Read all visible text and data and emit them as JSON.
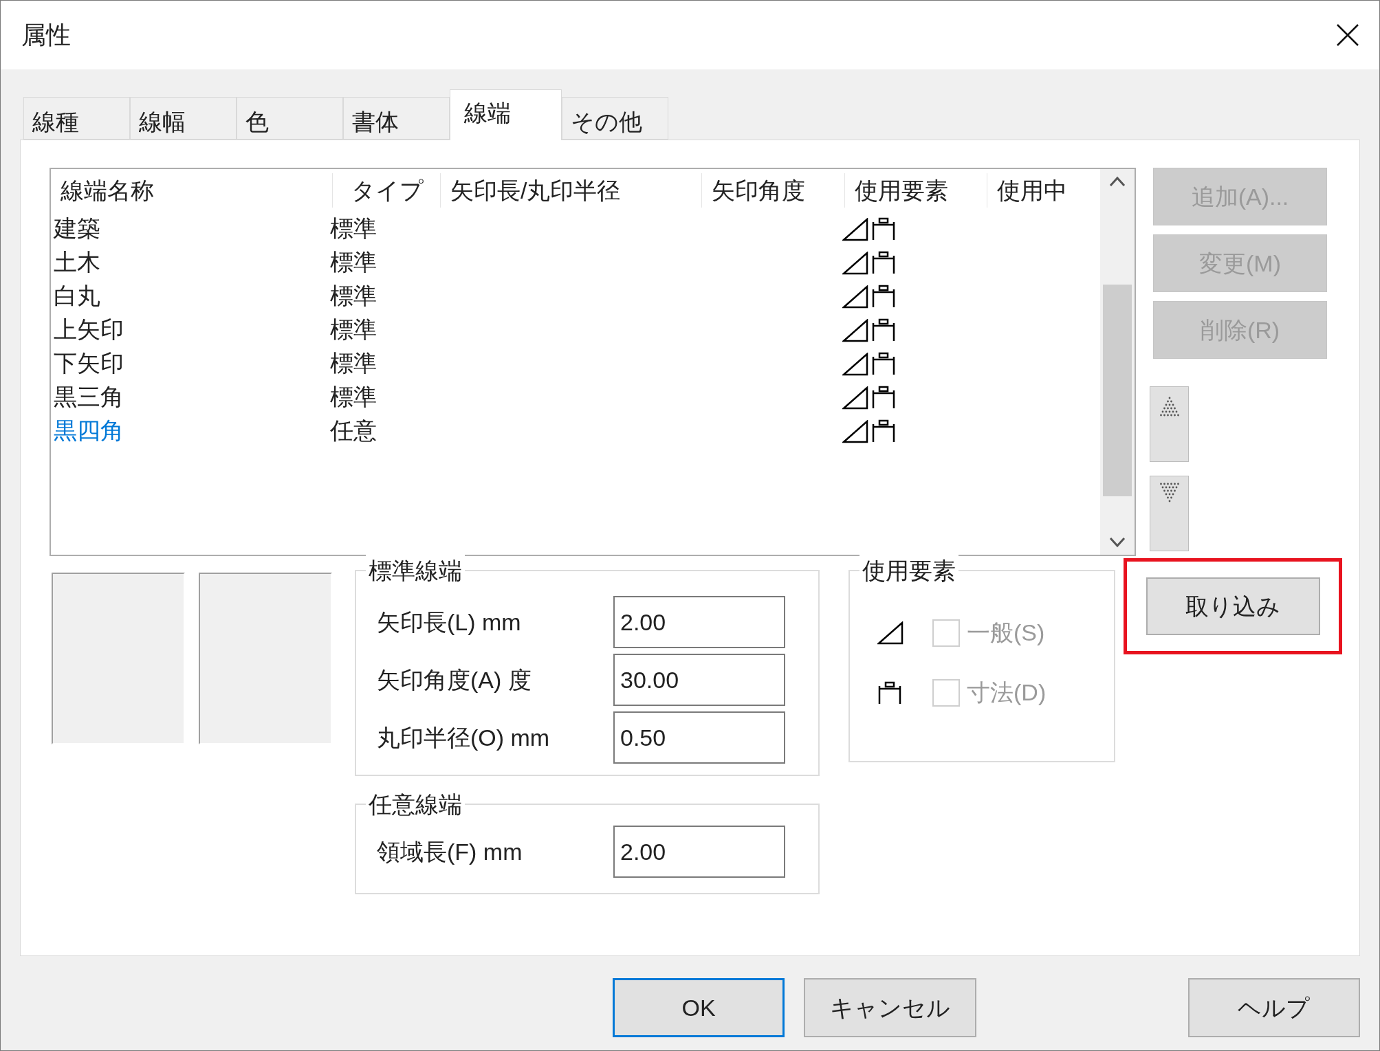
{
  "window": {
    "title": "属性"
  },
  "tabs": [
    {
      "label": "線種",
      "selected": false
    },
    {
      "label": "線幅",
      "selected": false
    },
    {
      "label": "色",
      "selected": false
    },
    {
      "label": "書体",
      "selected": false
    },
    {
      "label": "線端",
      "selected": true
    },
    {
      "label": "その他",
      "selected": false
    }
  ],
  "list": {
    "columns": [
      "線端名称",
      "タイプ",
      "矢印長/丸印半径",
      "矢印角度",
      "使用要素",
      "使用中"
    ],
    "rows": [
      {
        "name": "建築",
        "type": "標準",
        "selected": false
      },
      {
        "name": "土木",
        "type": "標準",
        "selected": false
      },
      {
        "name": "白丸",
        "type": "標準",
        "selected": false
      },
      {
        "name": "上矢印",
        "type": "標準",
        "selected": false
      },
      {
        "name": "下矢印",
        "type": "標準",
        "selected": false
      },
      {
        "name": "黒三角",
        "type": "標準",
        "selected": false
      },
      {
        "name": "黒四角",
        "type": "任意",
        "selected": true
      }
    ]
  },
  "side_buttons": [
    {
      "label": "追加(A)...",
      "disabled": true
    },
    {
      "label": "変更(M)",
      "disabled": true
    },
    {
      "label": "削除(R)",
      "disabled": true
    }
  ],
  "standard_end": {
    "title": "標準線端",
    "fields": [
      {
        "label": "矢印長(L) mm",
        "value": "2.00"
      },
      {
        "label": "矢印角度(A) 度",
        "value": "30.00"
      },
      {
        "label": "丸印半径(O) mm",
        "value": "0.50"
      }
    ]
  },
  "arbitrary_end": {
    "title": "任意線端",
    "fields": [
      {
        "label": "領域長(F) mm",
        "value": "2.00"
      }
    ]
  },
  "usage": {
    "title": "使用要素",
    "options": [
      {
        "kind": "general",
        "label": "一般(S)",
        "checked": false,
        "disabled": true
      },
      {
        "kind": "dimension",
        "label": "寸法(D)",
        "checked": false,
        "disabled": true
      }
    ]
  },
  "import_button": {
    "label": "取り込み",
    "highlighted": true
  },
  "footer_buttons": [
    {
      "label": "OK",
      "default": true
    },
    {
      "label": "キャンセル",
      "default": false
    },
    {
      "label": "ヘルプ",
      "default": false
    }
  ]
}
